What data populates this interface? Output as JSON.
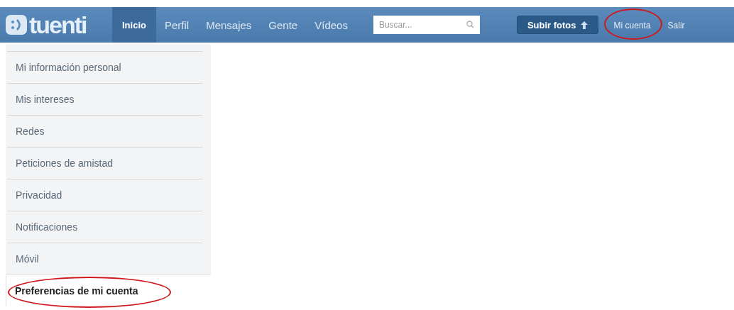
{
  "logo": {
    "text": "tuenti"
  },
  "nav": {
    "items": [
      {
        "label": "Inicio",
        "selected": true
      },
      {
        "label": "Perfil",
        "selected": false
      },
      {
        "label": "Mensajes",
        "selected": false
      },
      {
        "label": "Gente",
        "selected": false
      },
      {
        "label": "Vídeos",
        "selected": false
      }
    ],
    "search": {
      "placeholder": "Buscar..."
    },
    "upload_button": {
      "label": "Subir fotos"
    },
    "account_links": [
      {
        "label": "Mi cuenta",
        "circled": true
      },
      {
        "label": "Salir",
        "circled": false
      }
    ]
  },
  "sidebar": {
    "items": [
      {
        "label": "Mi información personal",
        "selected": false,
        "circled": false
      },
      {
        "label": "Mis intereses",
        "selected": false,
        "circled": false
      },
      {
        "label": "Redes",
        "selected": false,
        "circled": false
      },
      {
        "label": "Peticiones de amistad",
        "selected": false,
        "circled": false
      },
      {
        "label": "Privacidad",
        "selected": false,
        "circled": false
      },
      {
        "label": "Notificaciones",
        "selected": false,
        "circled": false
      },
      {
        "label": "Móvil",
        "selected": false,
        "circled": false
      },
      {
        "label": "Preferencias de mi cuenta",
        "selected": true,
        "circled": true
      }
    ]
  }
}
